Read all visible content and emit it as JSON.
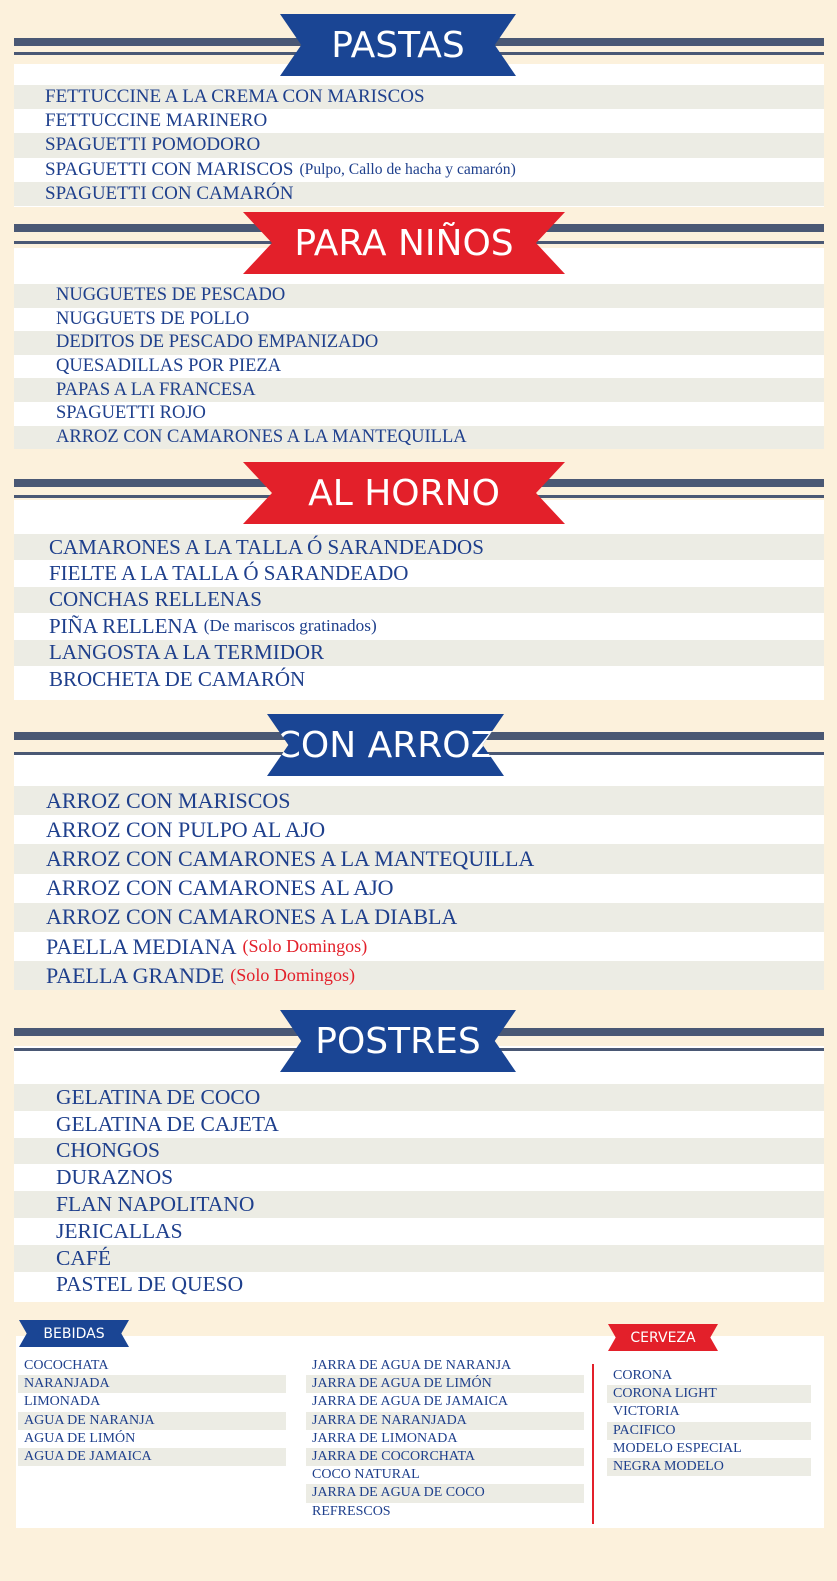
{
  "pastas": {
    "title": "PASTAS",
    "items": [
      {
        "name": "FETTUCCINE A LA CREMA CON MARISCOS",
        "note": ""
      },
      {
        "name": "FETTUCCINE MARINERO",
        "note": ""
      },
      {
        "name": "SPAGUETTI POMODORO",
        "note": ""
      },
      {
        "name": "SPAGUETTI CON MARISCOS",
        "note": "(Pulpo, Callo de hacha y camarón)"
      },
      {
        "name": "SPAGUETTI CON CAMARÓN",
        "note": ""
      }
    ]
  },
  "ninos": {
    "title": "PARA NIÑOS",
    "items": [
      "NUGGUETES DE PESCADO",
      "NUGGUETS DE POLLO",
      "DEDITOS DE PESCADO EMPANIZADO",
      "QUESADILLAS POR PIEZA",
      "PAPAS A LA FRANCESA",
      "SPAGUETTI ROJO",
      "ARROZ CON CAMARONES A LA MANTEQUILLA"
    ]
  },
  "horno": {
    "title": "AL HORNO",
    "items": [
      {
        "name": "CAMARONES A LA TALLA Ó SARANDEADOS",
        "note": ""
      },
      {
        "name": "FIELTE A LA TALLA Ó SARANDEADO",
        "note": ""
      },
      {
        "name": "CONCHAS RELLENAS",
        "note": ""
      },
      {
        "name": "PIÑA RELLENA",
        "note": "(De mariscos gratinados)"
      },
      {
        "name": "LANGOSTA A LA TERMIDOR",
        "note": ""
      },
      {
        "name": "BROCHETA DE CAMARÓN",
        "note": ""
      }
    ]
  },
  "arroz": {
    "title": "CON ARROZ",
    "items": [
      {
        "name": "ARROZ CON MARISCOS",
        "note": ""
      },
      {
        "name": "ARROZ CON PULPO AL AJO",
        "note": ""
      },
      {
        "name": "ARROZ CON CAMARONES A LA MANTEQUILLA",
        "note": ""
      },
      {
        "name": "ARROZ CON CAMARONES AL AJO",
        "note": ""
      },
      {
        "name": "ARROZ CON CAMARONES A LA DIABLA",
        "note": ""
      },
      {
        "name": "PAELLA MEDIANA",
        "note": "(Solo Domingos)"
      },
      {
        "name": "PAELLA GRANDE",
        "note": "(Solo Domingos)"
      }
    ]
  },
  "postres": {
    "title": "POSTRES",
    "items": [
      "GELATINA DE COCO",
      "GELATINA DE CAJETA",
      "CHONGOS",
      "DURAZNOS",
      "FLAN NAPOLITANO",
      "JERICALLAS",
      "CAFÉ",
      "PASTEL DE QUESO"
    ]
  },
  "bebidas": {
    "title": "BEBIDAS",
    "col1": [
      "COCOCHATA",
      "NARANJADA",
      "LIMONADA",
      "AGUA DE NARANJA",
      "AGUA DE LIMÓN",
      "AGUA DE JAMAICA"
    ],
    "col2": [
      "JARRA DE AGUA DE NARANJA",
      "JARRA DE AGUA DE LIMÓN",
      "JARRA DE AGUA DE JAMAICA",
      "JARRA DE NARANJADA",
      "JARRA DE LIMONADA",
      "JARRA DE COCORCHATA",
      "COCO NATURAL",
      "JARRA DE AGUA DE COCO",
      "REFRESCOS"
    ]
  },
  "cerveza": {
    "title": "CERVEZA",
    "items": [
      "CORONA",
      "CORONA LIGHT",
      "VICTORIA",
      "PACIFICO",
      "MODELO ESPECIAL",
      "NEGRA MODELO"
    ]
  },
  "colors": {
    "blue": "#1a4594",
    "red": "#e3202a",
    "navy_text": "#1e3f8c",
    "stripe": "#4a5874",
    "cream": "#fcf1dc"
  }
}
